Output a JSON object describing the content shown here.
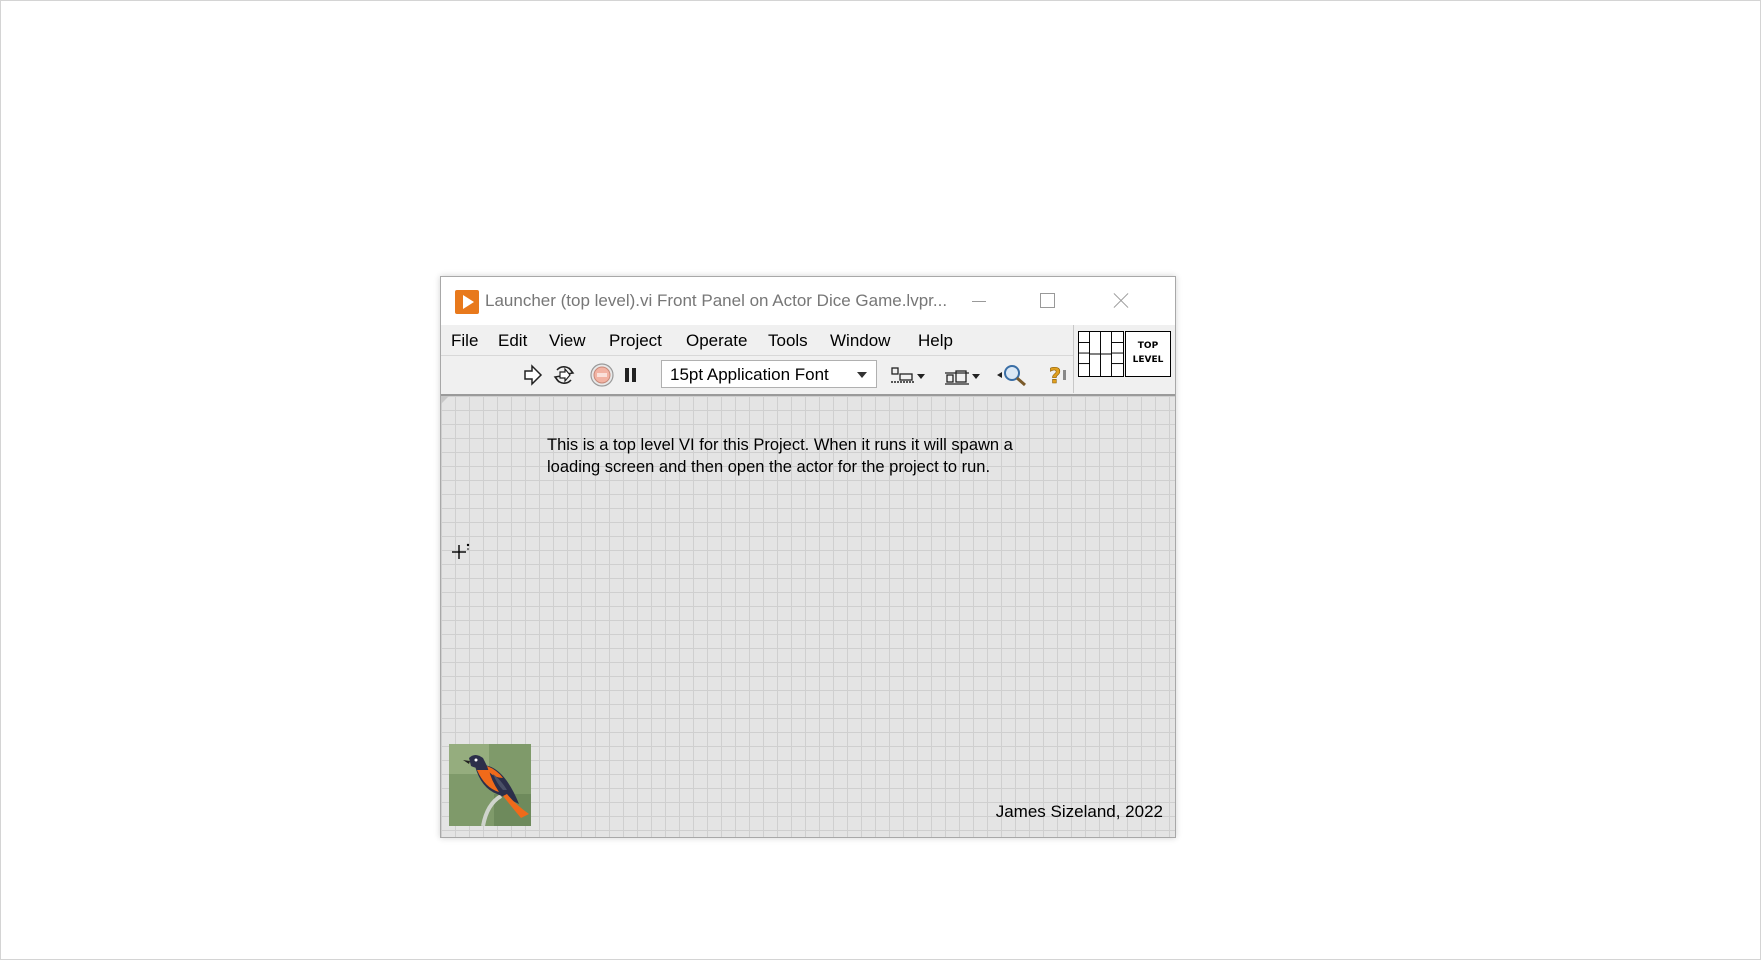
{
  "window": {
    "title": "Launcher (top level).vi Front Panel on Actor Dice Game.lvpr..."
  },
  "menu": {
    "items": [
      {
        "label": "File"
      },
      {
        "label": "Edit"
      },
      {
        "label": "View"
      },
      {
        "label": "Project"
      },
      {
        "label": "Operate"
      },
      {
        "label": "Tools"
      },
      {
        "label": "Window"
      },
      {
        "label": "Help"
      }
    ]
  },
  "toolbar": {
    "font_selection": "15pt Application Font",
    "icons": [
      "run-arrow-icon",
      "run-continuously-icon",
      "abort-icon",
      "pause-icon",
      "align-icon",
      "distribute-icon",
      "zoom-icon",
      "help-icon"
    ]
  },
  "vi_icon": {
    "line1": "TOP",
    "line2": "LEVEL"
  },
  "panel": {
    "description_line1": "This is a top level VI for this Project.  When it runs it will spawn a",
    "description_line2": "loading screen and then open the actor for the project to run.",
    "credit": "James Sizeland, 2022"
  },
  "colors": {
    "app_icon": "#e8791c",
    "panel_bg": "#e4e4e4",
    "grid_line": "#cfcfcf",
    "bird_orange": "#f06a1a",
    "bird_dark": "#2c2f4a"
  }
}
